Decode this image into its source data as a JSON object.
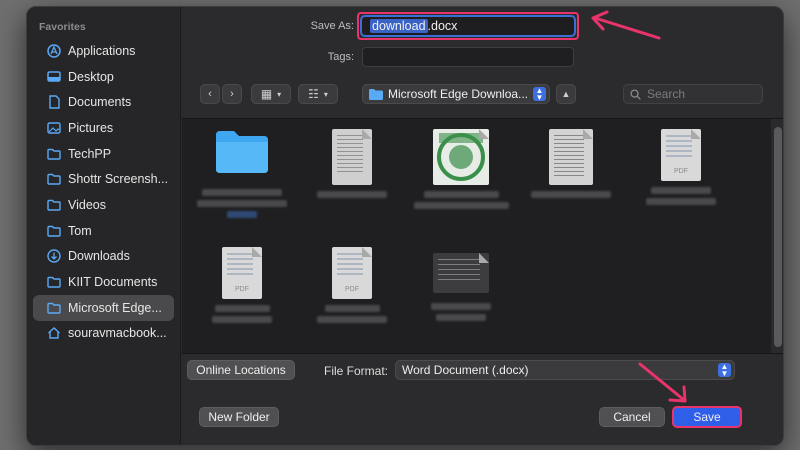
{
  "sidebar": {
    "heading": "Favorites",
    "items": [
      {
        "label": "Applications",
        "icon": "applications-icon"
      },
      {
        "label": "Desktop",
        "icon": "desktop-icon"
      },
      {
        "label": "Documents",
        "icon": "document-icon"
      },
      {
        "label": "Pictures",
        "icon": "pictures-icon"
      },
      {
        "label": "TechPP",
        "icon": "folder-icon"
      },
      {
        "label": "Shottr Screensh...",
        "icon": "folder-icon"
      },
      {
        "label": "Videos",
        "icon": "folder-icon"
      },
      {
        "label": "Tom",
        "icon": "folder-icon"
      },
      {
        "label": "Downloads",
        "icon": "download-icon"
      },
      {
        "label": "KIIT Documents",
        "icon": "folder-icon"
      },
      {
        "label": "Microsoft Edge...",
        "icon": "folder-icon"
      },
      {
        "label": "souravmacbook...",
        "icon": "home-icon"
      }
    ]
  },
  "save_as": {
    "label": "Save As:",
    "value_name": "download",
    "value_ext": ".docx"
  },
  "tags": {
    "label": "Tags:"
  },
  "toolbar": {
    "location": "Microsoft Edge Downloa...",
    "search_placeholder": "Search"
  },
  "files": [
    {
      "kind": "folder"
    },
    {
      "kind": "doc"
    },
    {
      "kind": "logo"
    },
    {
      "kind": "doc"
    },
    {
      "kind": "pdf",
      "tag": "PDF"
    },
    {
      "kind": "pdf",
      "tag": "PDF"
    },
    {
      "kind": "pdf",
      "tag": "PDF"
    },
    {
      "kind": "doc-wide"
    }
  ],
  "bottom": {
    "online_locations": "Online Locations",
    "file_format_label": "File Format:",
    "file_format_value": "Word Document (.docx)",
    "new_folder": "New Folder",
    "cancel": "Cancel",
    "save": "Save"
  },
  "colors": {
    "accent": "#2f5fe8",
    "highlight": "#e8336b"
  }
}
